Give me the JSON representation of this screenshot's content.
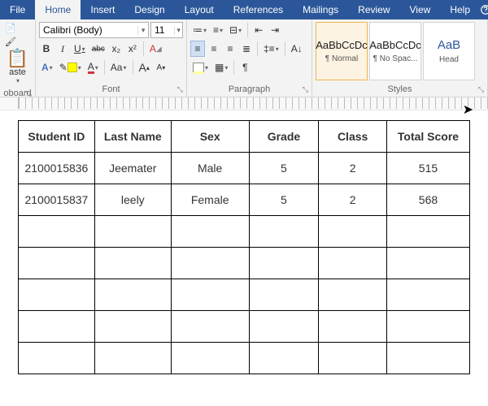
{
  "tabs": {
    "file": "File",
    "home": "Home",
    "insert": "Insert",
    "design": "Design",
    "layout": "Layout",
    "references": "References",
    "mailings": "Mailings",
    "review": "Review",
    "view": "View",
    "help": "Help"
  },
  "ribbon": {
    "clipboard": {
      "label": "oboard",
      "paste": "aste"
    },
    "font": {
      "label": "Font",
      "name": "Calibri (Body)",
      "size": "11",
      "bold": "B",
      "italic": "I",
      "underline": "U",
      "strike": "abc",
      "sub": "x₂",
      "sup": "x²",
      "grow": "A",
      "shrink": "A",
      "case": "Aa",
      "clear": "A"
    },
    "paragraph": {
      "label": "Paragraph"
    },
    "styles": {
      "label": "Styles",
      "items": [
        {
          "preview": "AaBbCcDc",
          "name": "¶ Normal"
        },
        {
          "preview": "AaBbCcDc",
          "name": "¶ No Spac..."
        },
        {
          "preview": "AaB",
          "name": "Head"
        }
      ]
    }
  },
  "table": {
    "headers": [
      "Student ID",
      "Last Name",
      "Sex",
      "Grade",
      "Class",
      "Total Score"
    ],
    "rows": [
      [
        "2100015836",
        "Jeemater",
        "Male",
        "5",
        "2",
        "515"
      ],
      [
        "2100015837",
        "leely",
        "Female",
        "5",
        "2",
        "568"
      ],
      [
        "",
        "",
        "",
        "",
        "",
        ""
      ],
      [
        "",
        "",
        "",
        "",
        "",
        ""
      ],
      [
        "",
        "",
        "",
        "",
        "",
        ""
      ],
      [
        "",
        "",
        "",
        "",
        "",
        ""
      ],
      [
        "",
        "",
        "",
        "",
        "",
        ""
      ]
    ]
  }
}
